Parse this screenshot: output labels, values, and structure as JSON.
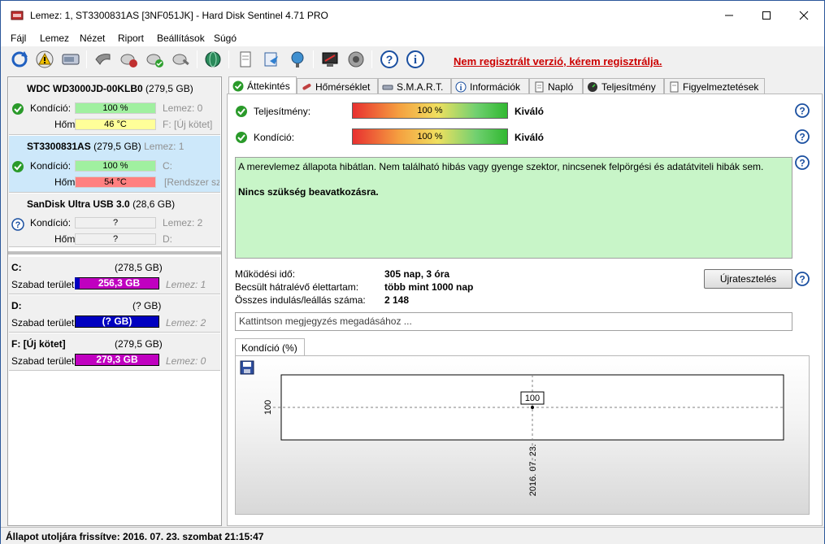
{
  "window": {
    "title": "Lemez: 1, ST3300831AS [3NF051JK]  -  Hard Disk Sentinel 4.71 PRO"
  },
  "menu": [
    "Fájl",
    "Lemez",
    "Nézet",
    "Riport",
    "Beállítások",
    "Súgó"
  ],
  "toolbar": {
    "register_text": "Nem regisztrált verzió, kérem regisztrálja."
  },
  "disks": [
    {
      "name": "WDC WD3000JD-00KLB0",
      "size": "(279,5 GB)",
      "extra": "",
      "status": "ok",
      "kond_label": "Kondíció:",
      "kond_value": "100 %",
      "kond_percent": 100,
      "kond_right": "Lemez: 0",
      "hom_label": "Hőm.:",
      "hom_value": "46 °C",
      "hom_color": "#ffff99",
      "hom_right": "F: [Új kötet]"
    },
    {
      "name": "ST3300831AS",
      "size": "(279,5 GB)",
      "extra": "Lemez: 1",
      "status": "ok",
      "kond_label": "Kondíció:",
      "kond_value": "100 %",
      "kond_percent": 100,
      "kond_right": "C:",
      "hom_label": "Hőm.:",
      "hom_value": "54 °C",
      "hom_color": "#ff8080",
      "hom_right": "[Rendszer szá"
    },
    {
      "name": "SanDisk Ultra USB 3.0",
      "size": "(28,6 GB)",
      "extra": "",
      "status": "unknown",
      "kond_label": "Kondíció:",
      "kond_value": "?",
      "kond_percent": 0,
      "kond_right": "Lemez: 2",
      "hom_label": "Hőm.:",
      "hom_value": "?",
      "hom_color": "#f0f0f0",
      "hom_right": "D:"
    }
  ],
  "volumes": [
    {
      "name": "C:",
      "size": "(278,5 GB)",
      "free_label": "Szabad terület",
      "free_value": "256,3 GB",
      "color": "#c000c0",
      "color2": "#0000c0",
      "disk": "Lemez: 1"
    },
    {
      "name": "D:",
      "size": "(? GB)",
      "free_label": "Szabad terület",
      "free_value": "(? GB)",
      "color": "#0000c0",
      "color2": "#0000c0",
      "disk": "Lemez: 2"
    },
    {
      "name": "F: [Új kötet]",
      "size": "(279,5 GB)",
      "free_label": "Szabad terület",
      "free_value": "279,3 GB",
      "color": "#c000c0",
      "color2": "#c000c0",
      "disk": "Lemez: 0"
    }
  ],
  "tabs": [
    "Áttekintés",
    "Hőmérséklet",
    "S.M.A.R.T.",
    "Információk",
    "Napló",
    "Teljesítmény",
    "Figyelmeztetések"
  ],
  "overview": {
    "perf_label": "Teljesítmény:",
    "perf_value": "100 %",
    "perf_rating": "Kiváló",
    "cond_label": "Kondíció:",
    "cond_value": "100 %",
    "cond_rating": "Kiváló",
    "message_line1": "A merevlemez állapota hibátlan. Nem található hibás vagy gyenge szektor, nincsenek felpörgési és adatátviteli hibák sem.",
    "message_line2": "Nincs szükség beavatkozásra.",
    "uptime_label": "Működési idő:",
    "uptime_value": "305 nap, 3 óra",
    "life_label": "Becsült hátralévő élettartam:",
    "life_value": "több mint 1000 nap",
    "starts_label": "Összes indulás/leállás száma:",
    "starts_value": "2 148",
    "retest_label": "Újratesztelés",
    "note_placeholder": "Kattintson megjegyzés megadásához ..."
  },
  "chart_data": {
    "type": "line",
    "tab_label": "Kondíció  (%)",
    "x": [
      "2016. 07. 23."
    ],
    "values": [
      100
    ],
    "y_tick_labels": [
      "100"
    ],
    "data_labels": [
      "100"
    ],
    "ylim": [
      0,
      200
    ]
  },
  "status": {
    "text": "Állapot utoljára frissítve: 2016. 07. 23. szombat 21:15:47"
  },
  "colors": {
    "accent": "#2b579a",
    "register": "#cc0000",
    "message_bg": "#c8f5c8",
    "ok_green": "#2a9a2a",
    "help_blue": "#1a4fa0"
  }
}
